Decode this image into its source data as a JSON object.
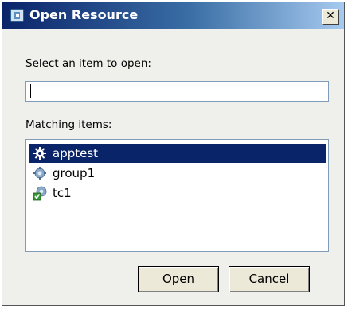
{
  "window": {
    "title": "Open Resource",
    "close_label": "x"
  },
  "select_prompt": "Select an item to open:",
  "search": {
    "value": "",
    "placeholder": ""
  },
  "matching_label": "Matching items:",
  "items": [
    {
      "label": "apptest",
      "icon": "app-gear-icon",
      "selected": true
    },
    {
      "label": "group1",
      "icon": "group-gear-icon",
      "selected": false
    },
    {
      "label": "tc1",
      "icon": "testcase-icon",
      "selected": false
    }
  ],
  "buttons": {
    "open": "Open",
    "cancel": "Cancel"
  },
  "colors": {
    "selection": "#0a246a",
    "titlebar_start": "#0a246a",
    "titlebar_end": "#a6caf0"
  }
}
